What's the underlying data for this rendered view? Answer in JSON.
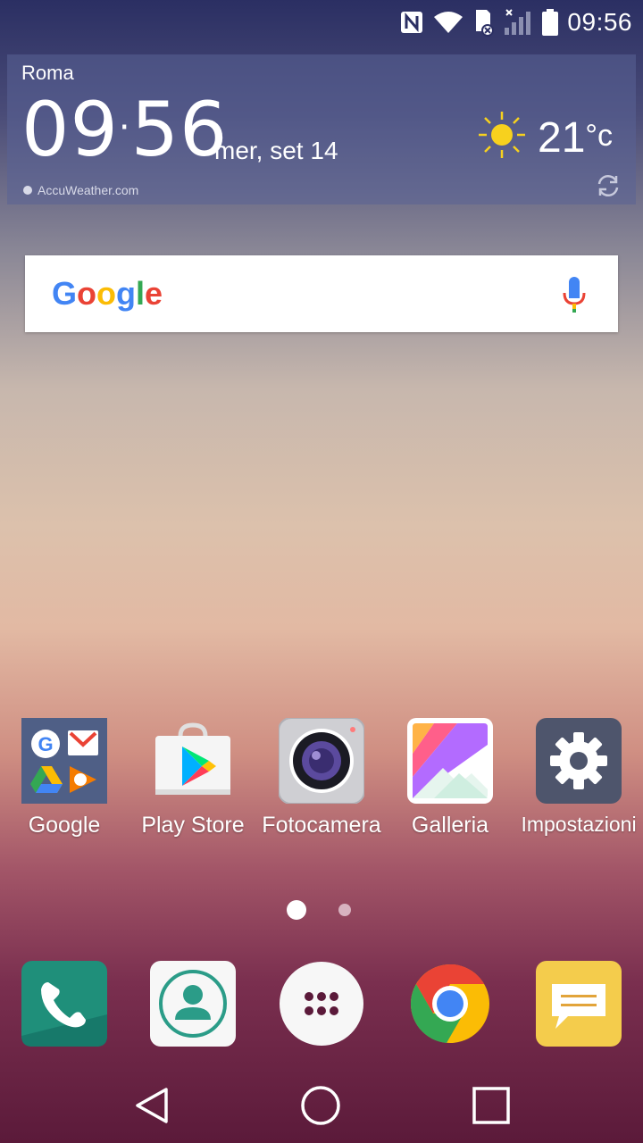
{
  "status_bar": {
    "time": "09:56",
    "icons": [
      "nfc-icon",
      "wifi-icon",
      "sd-card-icon",
      "signal-icon",
      "battery-icon"
    ]
  },
  "weather_widget": {
    "city": "Roma",
    "time_hours": "09",
    "time_minutes": "56",
    "date": "mer, set 14",
    "temperature": "21",
    "unit": "°c",
    "provider": "AccuWeather.com"
  },
  "search": {
    "logo_letters": [
      "G",
      "o",
      "o",
      "g",
      "l",
      "e"
    ],
    "logo_colors": [
      "#4285F4",
      "#EA4335",
      "#FBBC05",
      "#4285F4",
      "#34A853",
      "#EA4335"
    ]
  },
  "apps": [
    {
      "label": "Google"
    },
    {
      "label": "Play Store"
    },
    {
      "label": "Fotocamera"
    },
    {
      "label": "Galleria"
    },
    {
      "label": "Impostazioni"
    }
  ],
  "dock": [
    "phone-icon",
    "contacts-icon",
    "app-drawer-icon",
    "chrome-icon",
    "messages-icon"
  ],
  "pages": {
    "current": 1,
    "total": 2
  },
  "colors": {
    "phone": "#1f8f7a",
    "contacts_accent": "#2b9c88",
    "settings_bg": "#4e556c",
    "messages_bg": "#f4cc4c"
  }
}
